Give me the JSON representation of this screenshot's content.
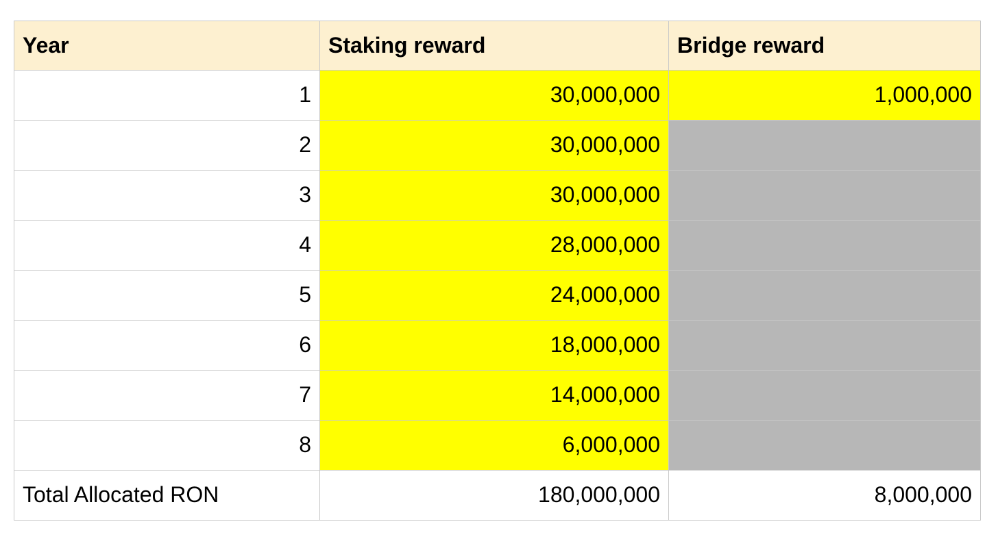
{
  "table": {
    "columns": [
      {
        "key": "year",
        "label": "Year"
      },
      {
        "key": "staking",
        "label": "Staking reward"
      },
      {
        "key": "bridge",
        "label": "Bridge reward"
      }
    ],
    "rows": [
      {
        "year": "1",
        "staking": "30,000,000",
        "bridge": "1,000,000",
        "staking_fill": "yellow",
        "bridge_fill": "yellow"
      },
      {
        "year": "2",
        "staking": "30,000,000",
        "bridge": "",
        "staking_fill": "yellow",
        "bridge_fill": "grey"
      },
      {
        "year": "3",
        "staking": "30,000,000",
        "bridge": "",
        "staking_fill": "yellow",
        "bridge_fill": "grey"
      },
      {
        "year": "4",
        "staking": "28,000,000",
        "bridge": "",
        "staking_fill": "yellow",
        "bridge_fill": "grey"
      },
      {
        "year": "5",
        "staking": "24,000,000",
        "bridge": "",
        "staking_fill": "yellow",
        "bridge_fill": "grey"
      },
      {
        "year": "6",
        "staking": "18,000,000",
        "bridge": "",
        "staking_fill": "yellow",
        "bridge_fill": "grey"
      },
      {
        "year": "7",
        "staking": "14,000,000",
        "bridge": "",
        "staking_fill": "yellow",
        "bridge_fill": "grey"
      },
      {
        "year": "8",
        "staking": "6,000,000",
        "bridge": "",
        "staking_fill": "yellow",
        "bridge_fill": "grey"
      }
    ],
    "total_row": {
      "label": "Total Allocated RON",
      "staking": "180,000,000",
      "bridge": "8,000,000"
    }
  },
  "colors": {
    "header_background": "#fdf0d0",
    "highlight_yellow": "#ffff00",
    "blocked_grey": "#b7b7b7",
    "cell_background": "#ffffff",
    "border": "#c8c8c8",
    "text": "#000000"
  }
}
